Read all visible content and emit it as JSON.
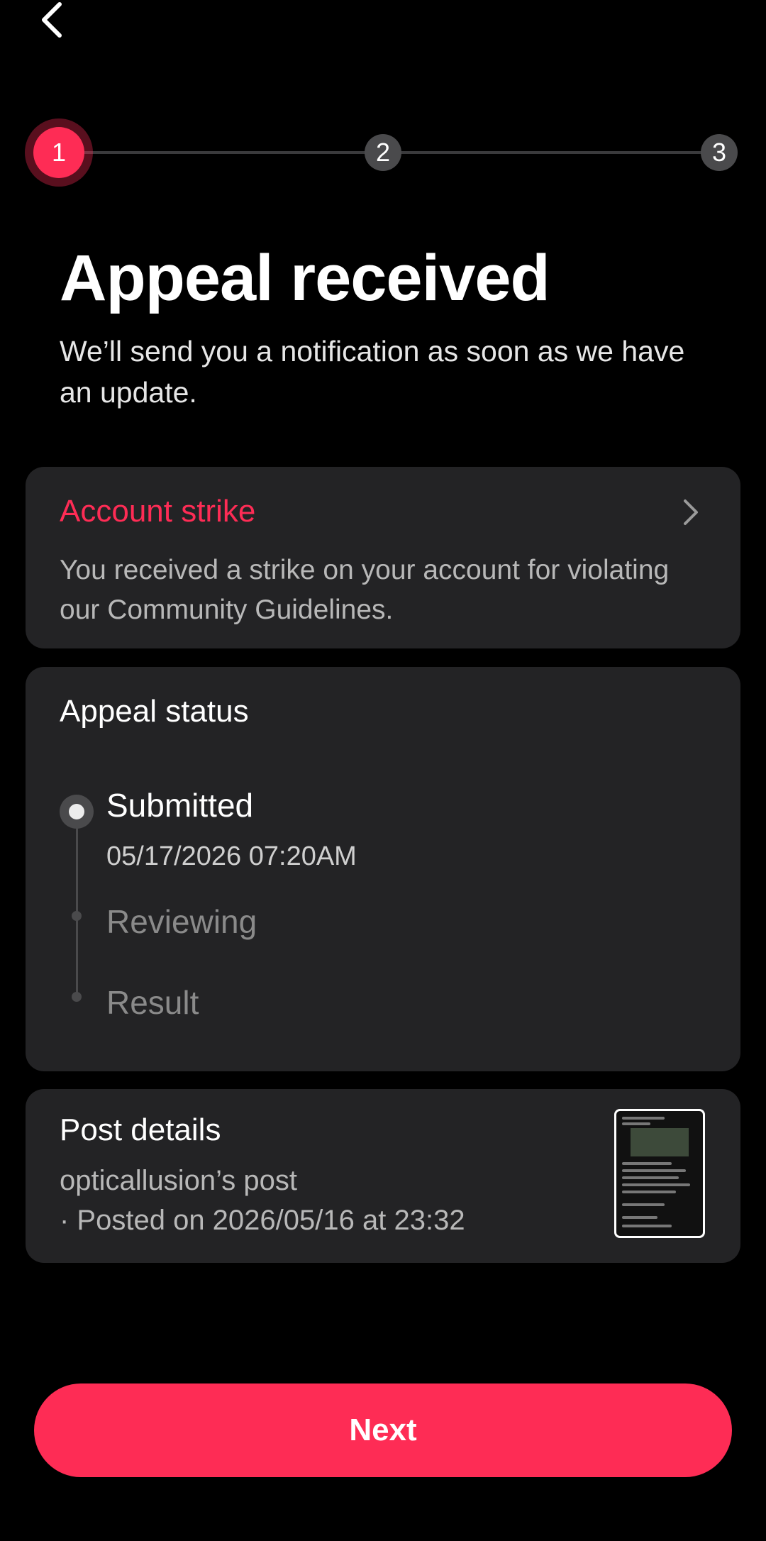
{
  "stepper": {
    "steps": [
      "1",
      "2",
      "3"
    ],
    "active": 1,
    "accent": "#fe2c55"
  },
  "header": {
    "title": "Appeal received",
    "subtitle": "We’ll send you a notification as soon as we have an update."
  },
  "strike_card": {
    "title": "Account strike",
    "description": "You received a strike on your account for violating our Community Guidelines."
  },
  "status_card": {
    "title": "Appeal status",
    "items": [
      {
        "label": "Submitted",
        "date": "05/17/2026 07:20AM",
        "state": "done"
      },
      {
        "label": "Reviewing",
        "state": "pending"
      },
      {
        "label": "Result",
        "state": "pending"
      }
    ]
  },
  "post_card": {
    "title": "Post details",
    "author_line": "opticallusion’s post",
    "posted_line": "· Posted on 2026/05/16 at 23:32"
  },
  "next_button": {
    "label": "Next"
  },
  "icons": {
    "back": "chevron-left-icon",
    "open": "chevron-right-icon"
  }
}
